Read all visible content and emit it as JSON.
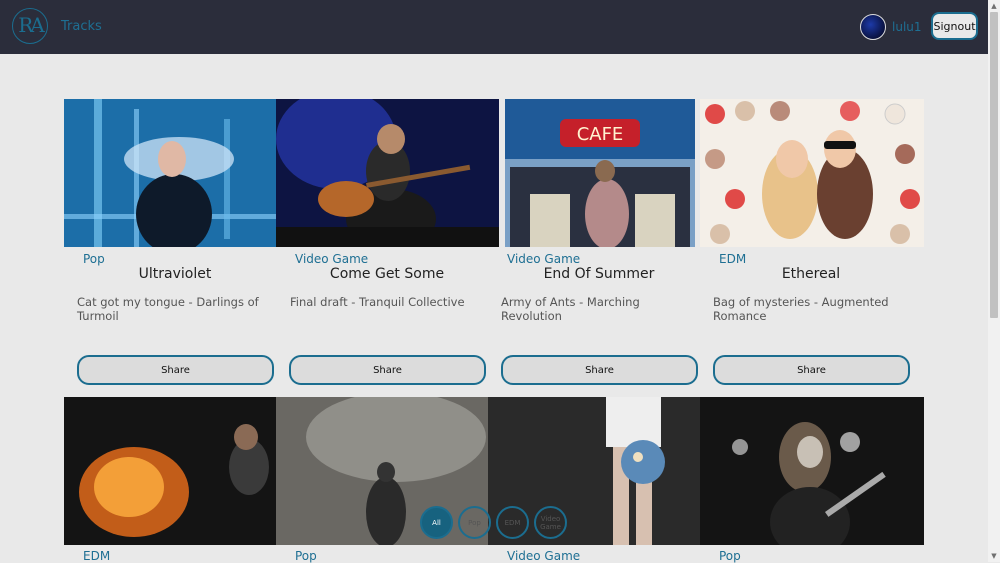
{
  "nav": {
    "logo_text": "RA",
    "link": "Tracks",
    "username": "lulu1",
    "signout": "Signout"
  },
  "tracks": [
    {
      "genre": "Pop",
      "title": "Ultraviolet",
      "meta": "Cat got my tongue  -  Darlings of Turmoil",
      "share": "Share"
    },
    {
      "genre": "Video Game",
      "title": "Come Get Some",
      "meta": "Final draft  -  Tranquil Collective",
      "share": "Share"
    },
    {
      "genre": "Video Game",
      "title": "End Of Summer",
      "meta": "Army of Ants  -  Marching Revolution",
      "share": "Share"
    },
    {
      "genre": "EDM",
      "title": "Ethereal",
      "meta": "Bag of mysteries  -  Augmented Romance",
      "share": "Share"
    }
  ],
  "row2": [
    {
      "genre": "EDM"
    },
    {
      "genre": "Pop"
    },
    {
      "genre": "Video Game"
    },
    {
      "genre": "Pop"
    }
  ],
  "filters": [
    "All",
    "Pop",
    "EDM",
    "Video Game"
  ]
}
